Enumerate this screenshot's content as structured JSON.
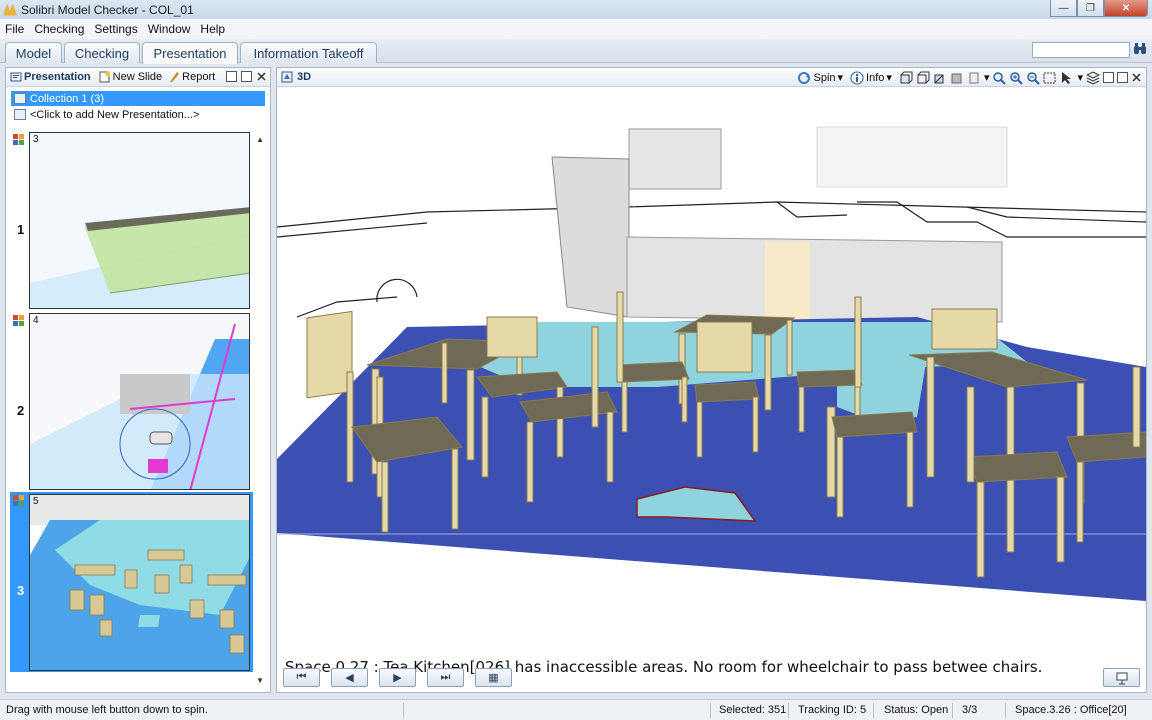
{
  "window": {
    "title": "Solibri Model Checker - COL_01",
    "minimize": "—",
    "maximize": "❐",
    "close": "✕"
  },
  "menu": [
    "File",
    "Checking",
    "Settings",
    "Window",
    "Help"
  ],
  "tabs": [
    "Model",
    "Checking",
    "Presentation",
    "Information Takeoff"
  ],
  "active_tab": "Presentation",
  "presentation_panel": {
    "title": "Presentation",
    "new_slide_label": "New Slide",
    "report_label": "Report",
    "collection_label": "Collection 1 (3)",
    "add_presentation_label": "<Click to add New Presentation...>",
    "slides": [
      {
        "number": "1",
        "label": "3"
      },
      {
        "number": "2",
        "label": "4"
      },
      {
        "number": "3",
        "label": "5"
      }
    ],
    "selected_slide": "3"
  },
  "view_panel": {
    "title": "3D",
    "spin_label": "Spin",
    "info_label": "Info",
    "issue_text": "Space.0.27 : Tea Kitchen[026] has inaccessible areas. No room for wheelchair to pass betwee chairs."
  },
  "statusbar": {
    "hint": "Drag with mouse left button down to spin.",
    "selected": "Selected: 351",
    "tracking_id": "Tracking ID: 5",
    "status": "Status: Open",
    "position": "3/3",
    "space": "Space.3.26 : Office[20]"
  },
  "colors": {
    "floor_blue": "#3c50b4",
    "accessible_cyan": "#8fd3df",
    "furniture": "#e6d9a8",
    "selection": "#3399ff"
  }
}
